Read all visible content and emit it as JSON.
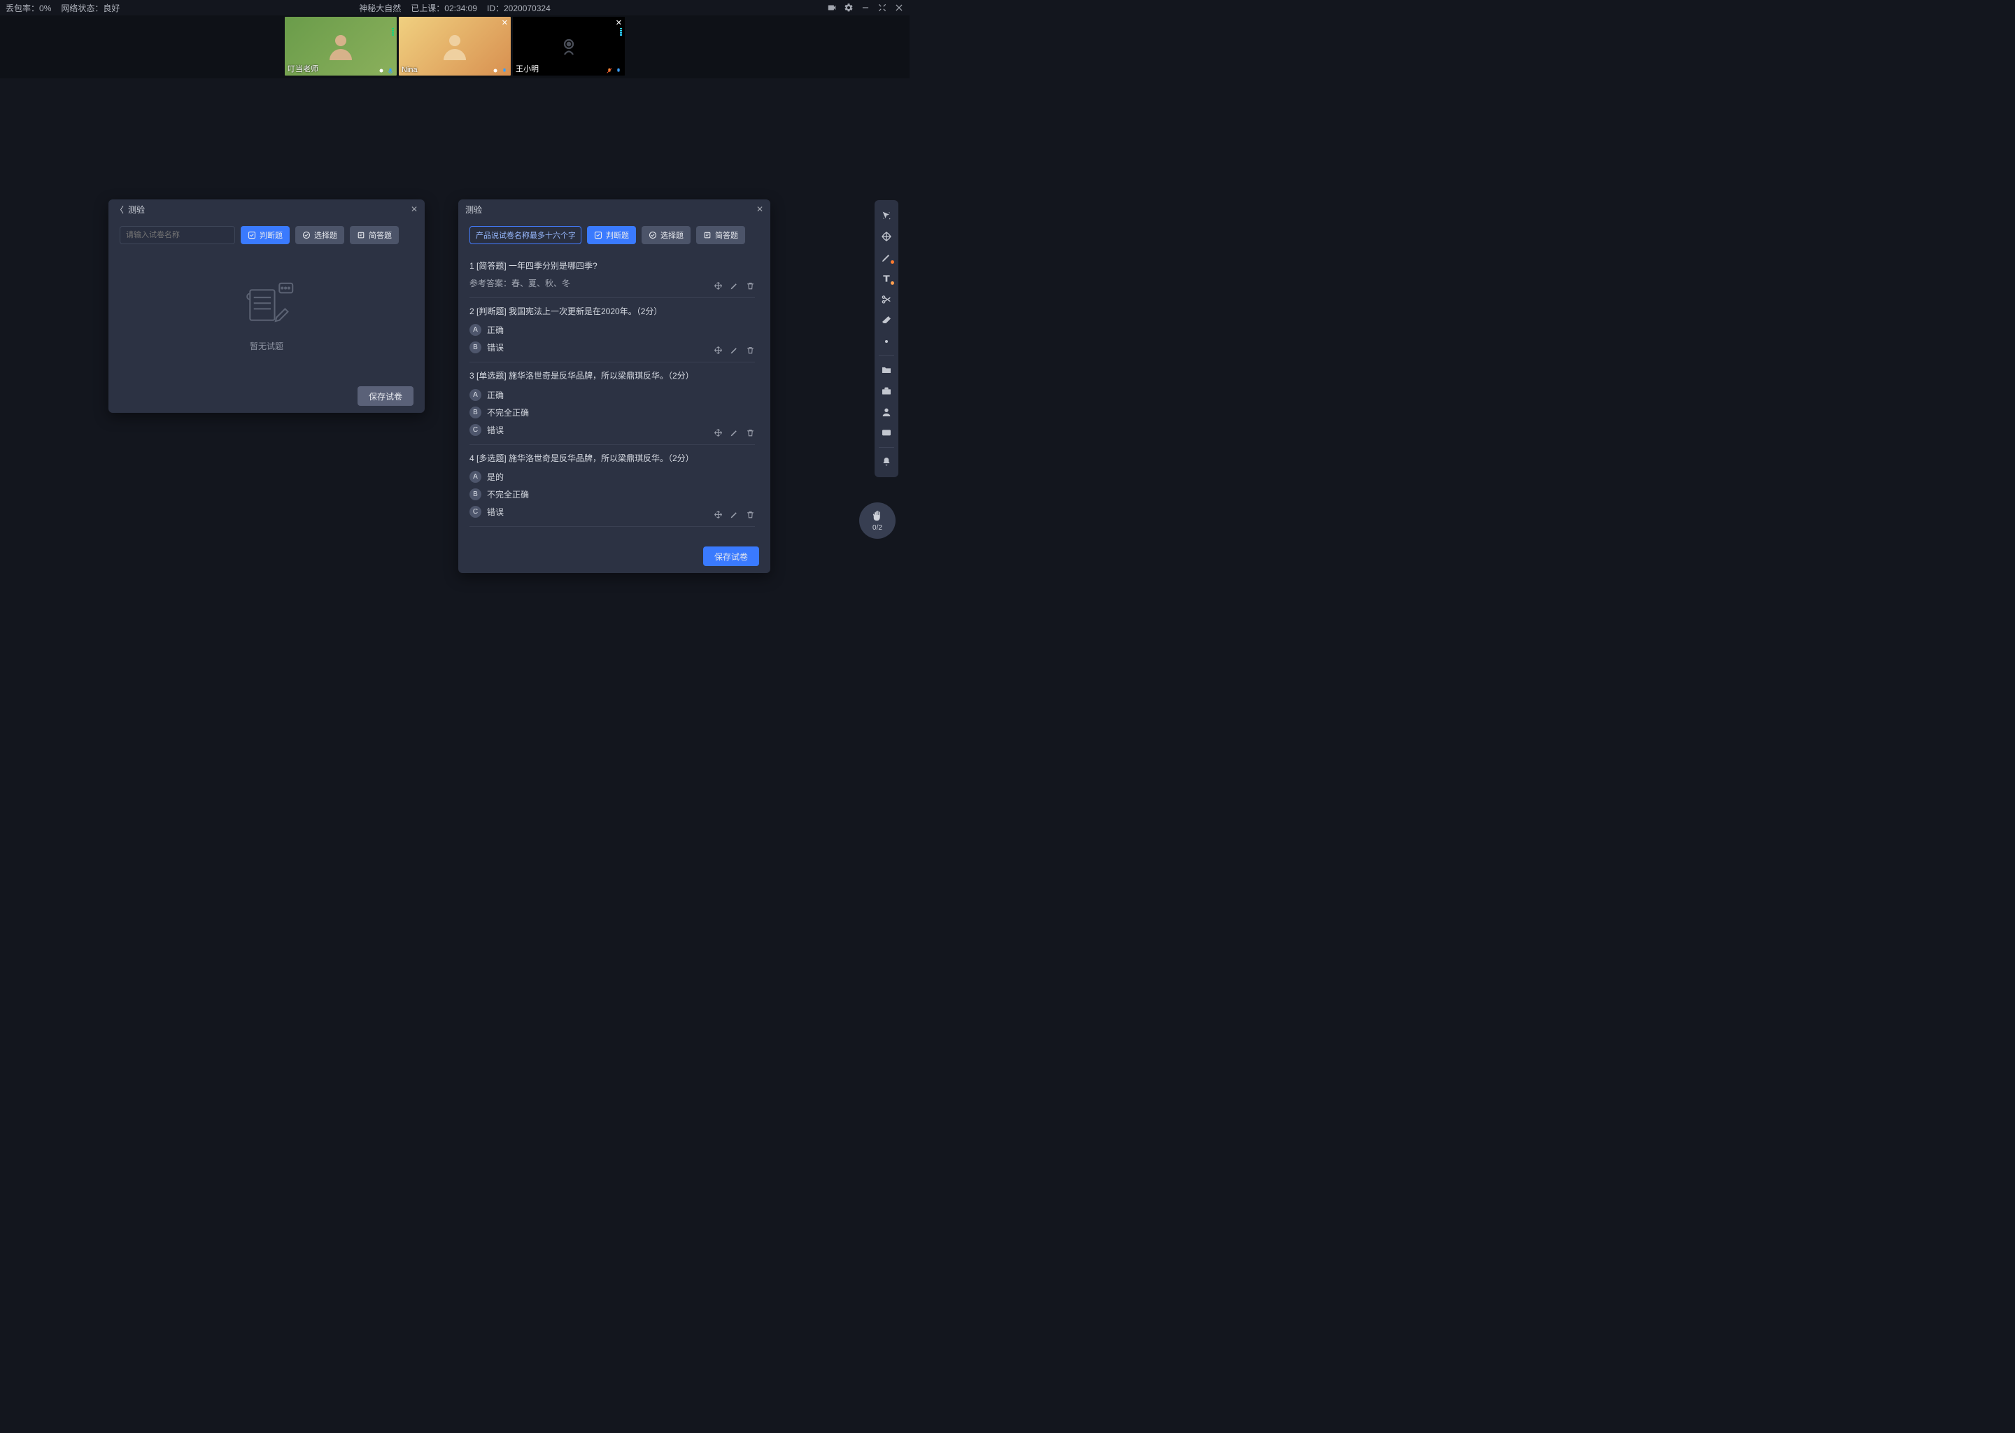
{
  "header": {
    "loss_rate_label": "丢包率：",
    "loss_rate_value": "0%",
    "network_label": "网络状态：",
    "network_value": "良好",
    "course_name": "神秘大自然",
    "elapsed_label": "已上课：",
    "elapsed_value": "02:34:09",
    "id_label": "ID：",
    "id_value": "2020070324"
  },
  "videos": [
    {
      "name": "叮当老师",
      "has_close": false,
      "camera_off": false
    },
    {
      "name": "Nina",
      "has_close": true,
      "camera_off": false
    },
    {
      "name": "王小明",
      "has_close": true,
      "camera_off": true
    }
  ],
  "quiz_left": {
    "title": "测验",
    "input_placeholder": "请输入试卷名称",
    "btn_judge": "判断题",
    "btn_choice": "选择题",
    "btn_short": "简答题",
    "empty_text": "暂无试题",
    "save_label": "保存试卷"
  },
  "quiz_right": {
    "title": "测验",
    "input_value": "产品说试卷名称最多十六个字",
    "btn_judge": "判断题",
    "btn_choice": "选择题",
    "btn_short": "简答题",
    "save_label": "保存试卷",
    "questions": [
      {
        "num": "1",
        "title": "[简答题] 一年四季分别是哪四季?",
        "answer_label": "参考答案：春、夏、秋、冬"
      },
      {
        "num": "2",
        "title": "[判断题] 我国宪法上一次更新是在2020年。（2分）",
        "options": [
          {
            "k": "A",
            "v": "正确"
          },
          {
            "k": "B",
            "v": "错误"
          }
        ]
      },
      {
        "num": "3",
        "title": "[单选题] 施华洛世奇是反华品牌，所以梁鼎琪反华。（2分）",
        "options": [
          {
            "k": "A",
            "v": "正确"
          },
          {
            "k": "B",
            "v": "不完全正确"
          },
          {
            "k": "C",
            "v": "错误"
          }
        ]
      },
      {
        "num": "4",
        "title": "[多选题] 施华洛世奇是反华品牌，所以梁鼎琪反华。（2分）",
        "options": [
          {
            "k": "A",
            "v": "是的"
          },
          {
            "k": "B",
            "v": "不完全正确"
          },
          {
            "k": "C",
            "v": "错误"
          }
        ]
      }
    ]
  },
  "hand": {
    "count": "0/2"
  }
}
